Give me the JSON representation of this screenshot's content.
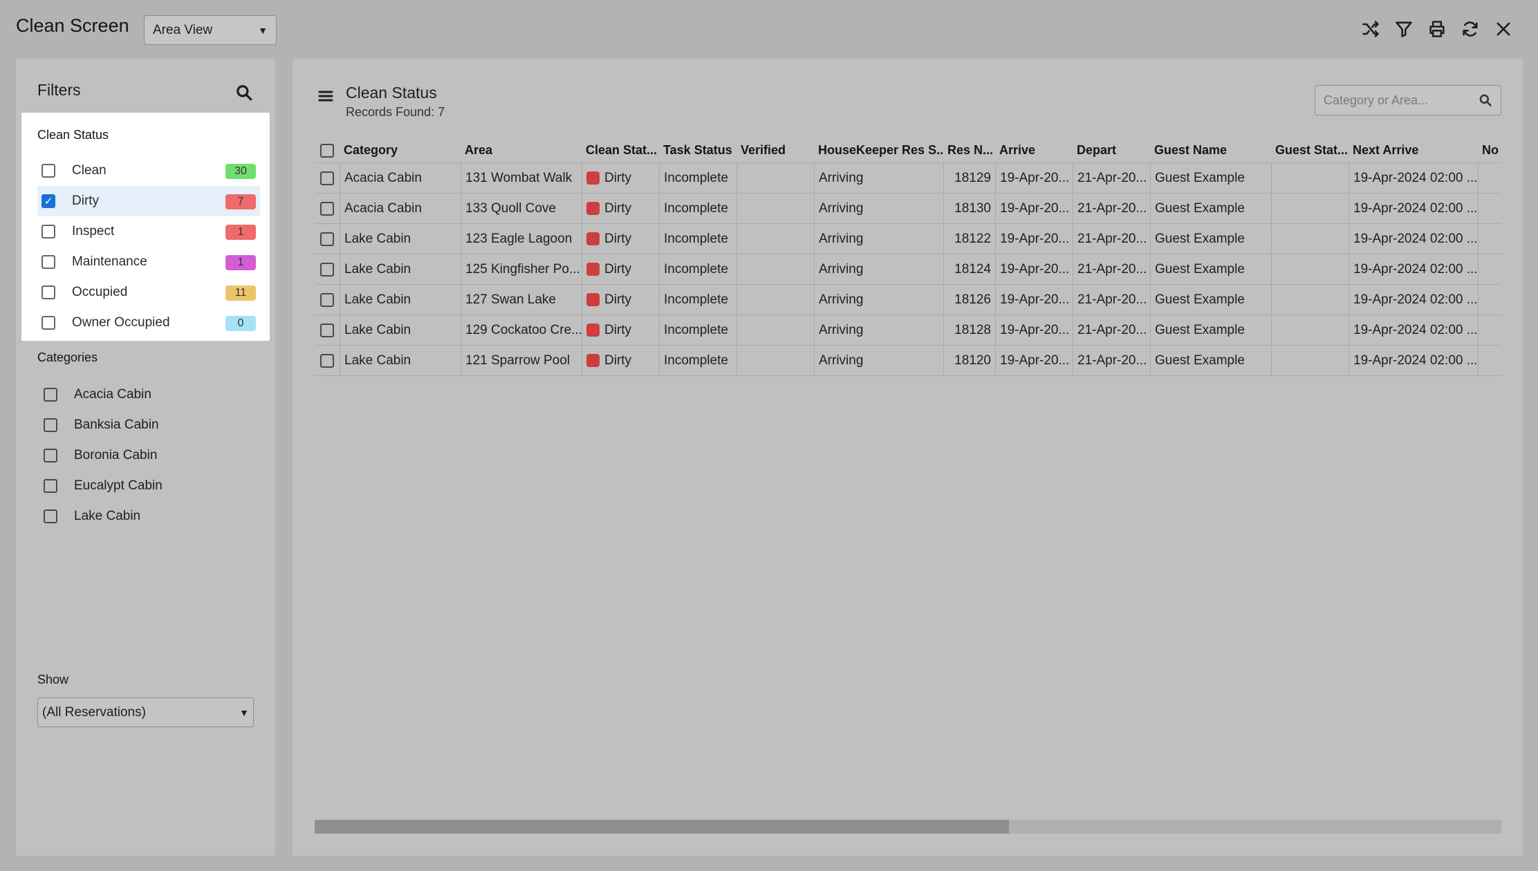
{
  "app": {
    "title": "Clean Screen",
    "view_select": "Area View"
  },
  "toolbar": {
    "icons": [
      "shuffle-icon",
      "filter-icon",
      "print-icon",
      "refresh-icon",
      "close-icon"
    ]
  },
  "filters": {
    "title": "Filters",
    "clean_status": {
      "title": "Clean Status",
      "items": [
        {
          "label": "Clean",
          "count": "30",
          "checked": false,
          "color": "#6fde6f"
        },
        {
          "label": "Dirty",
          "count": "7",
          "checked": true,
          "color": "#ef6b6b"
        },
        {
          "label": "Inspect",
          "count": "1",
          "checked": false,
          "color": "#ef6b6b"
        },
        {
          "label": "Maintenance",
          "count": "1",
          "checked": false,
          "color": "#d45cd6"
        },
        {
          "label": "Occupied",
          "count": "11",
          "checked": false,
          "color": "#ecc56a"
        },
        {
          "label": "Owner Occupied",
          "count": "0",
          "checked": false,
          "color": "#a6e2f5"
        }
      ]
    },
    "categories": {
      "title": "Categories",
      "items": [
        "Acacia Cabin",
        "Banksia Cabin",
        "Boronia Cabin",
        "Eucalypt Cabin",
        "Lake Cabin"
      ]
    },
    "show": {
      "title": "Show",
      "value": "(All Reservations)"
    }
  },
  "main": {
    "title": "Clean Status",
    "records": "Records Found: 7",
    "search_placeholder": "Category or Area..."
  },
  "grid": {
    "columns": [
      "Category",
      "Area",
      "Clean Stat...",
      "Task Status",
      "Verified",
      "HouseKeeper Res S...",
      "Res N...",
      "Arrive",
      "Depart",
      "Guest Name",
      "Guest Stat...",
      "Next Arrive",
      "No"
    ],
    "rows": [
      [
        "Acacia Cabin",
        "131 Wombat Walk",
        "Dirty",
        "Incomplete",
        "",
        "Arriving",
        "18129",
        "19-Apr-20...",
        "21-Apr-20...",
        "Guest Example",
        "",
        "19-Apr-2024 02:00 ...",
        ""
      ],
      [
        "Acacia Cabin",
        "133 Quoll Cove",
        "Dirty",
        "Incomplete",
        "",
        "Arriving",
        "18130",
        "19-Apr-20...",
        "21-Apr-20...",
        "Guest Example",
        "",
        "19-Apr-2024 02:00 ...",
        ""
      ],
      [
        "Lake Cabin",
        "123 Eagle Lagoon",
        "Dirty",
        "Incomplete",
        "",
        "Arriving",
        "18122",
        "19-Apr-20...",
        "21-Apr-20...",
        "Guest Example",
        "",
        "19-Apr-2024 02:00 ...",
        ""
      ],
      [
        "Lake Cabin",
        "125 Kingfisher Po...",
        "Dirty",
        "Incomplete",
        "",
        "Arriving",
        "18124",
        "19-Apr-20...",
        "21-Apr-20...",
        "Guest Example",
        "",
        "19-Apr-2024 02:00 ...",
        ""
      ],
      [
        "Lake Cabin",
        "127 Swan Lake",
        "Dirty",
        "Incomplete",
        "",
        "Arriving",
        "18126",
        "19-Apr-20...",
        "21-Apr-20...",
        "Guest Example",
        "",
        "19-Apr-2024 02:00 ...",
        ""
      ],
      [
        "Lake Cabin",
        "129 Cockatoo Cre...",
        "Dirty",
        "Incomplete",
        "",
        "Arriving",
        "18128",
        "19-Apr-20...",
        "21-Apr-20...",
        "Guest Example",
        "",
        "19-Apr-2024 02:00 ...",
        ""
      ],
      [
        "Lake Cabin",
        "121 Sparrow Pool",
        "Dirty",
        "Incomplete",
        "",
        "Arriving",
        "18120",
        "19-Apr-20...",
        "21-Apr-20...",
        "Guest Example",
        "",
        "19-Apr-2024 02:00 ...",
        ""
      ]
    ],
    "dirty_color": "#cf3e3e",
    "scroll_fraction": 0.585
  }
}
